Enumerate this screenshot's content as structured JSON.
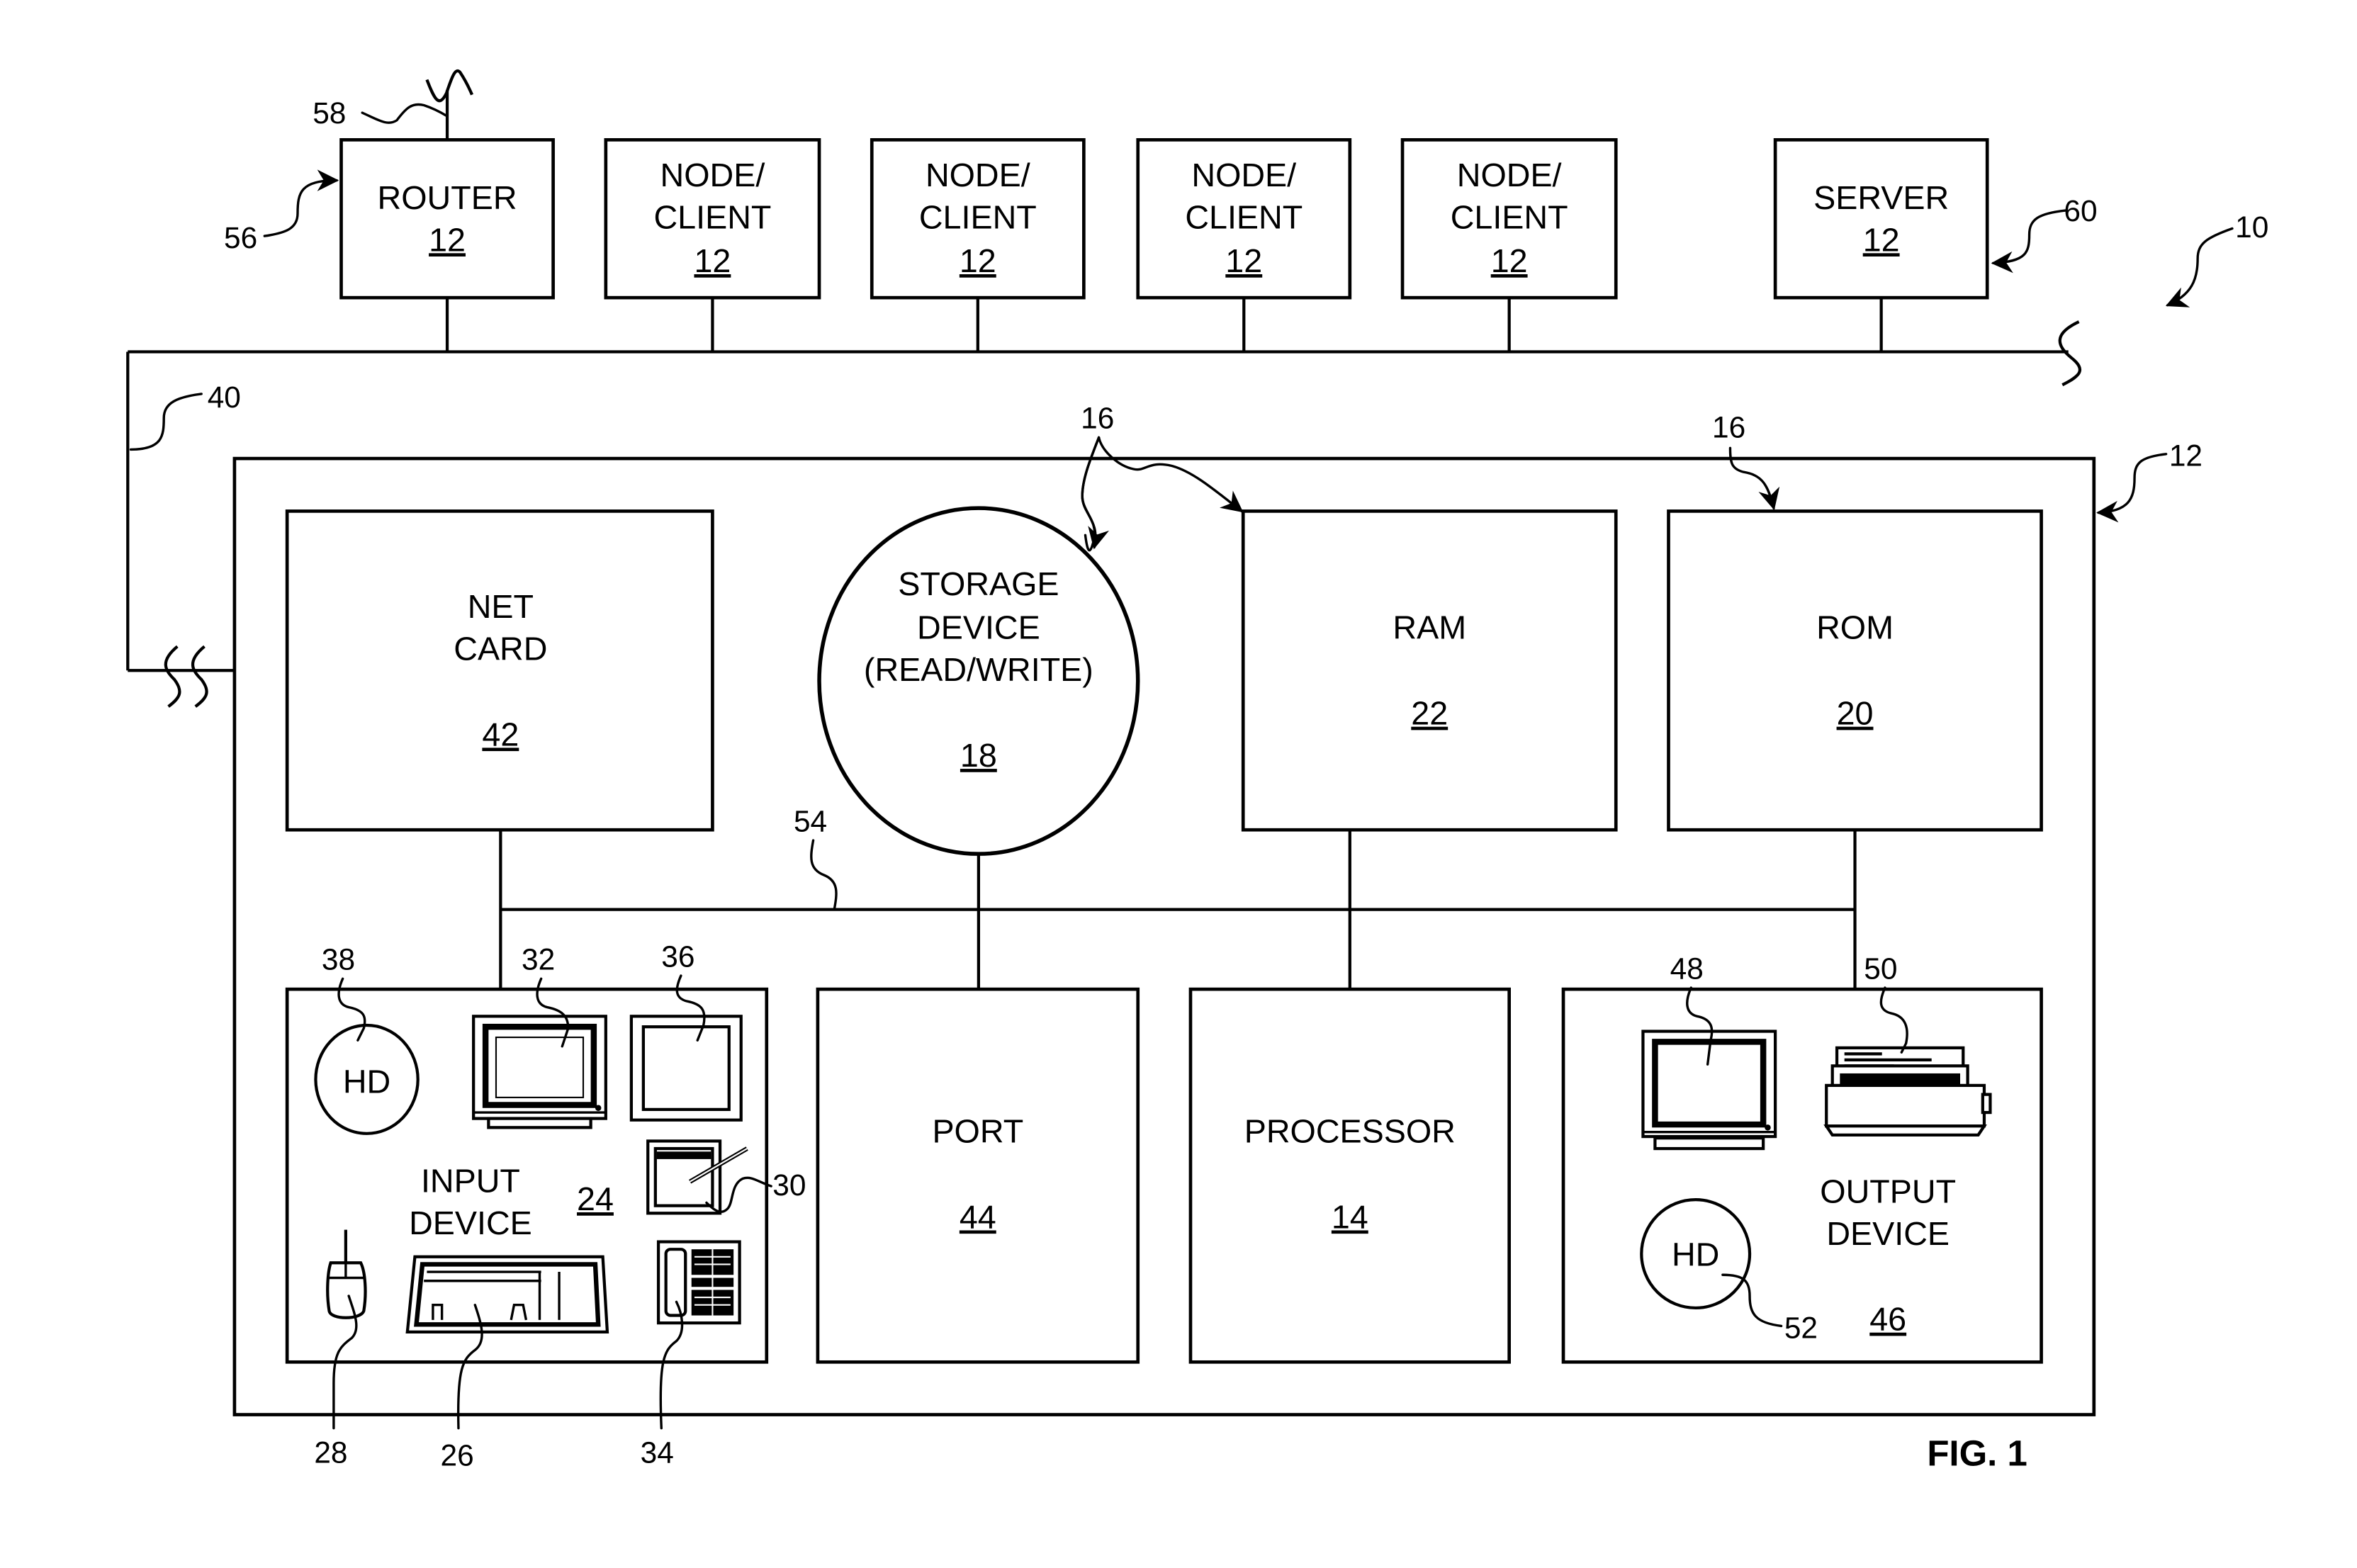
{
  "figure": {
    "title": "FIG. 1",
    "system_ref": "10",
    "computer_ref": "12"
  },
  "network": {
    "bus_ref": "40",
    "devices": [
      {
        "lines": [
          "ROUTER"
        ],
        "ref": "12",
        "callout": "56"
      },
      {
        "lines": [
          "NODE/",
          "CLIENT"
        ],
        "ref": "12"
      },
      {
        "lines": [
          "NODE/",
          "CLIENT"
        ],
        "ref": "12"
      },
      {
        "lines": [
          "NODE/",
          "CLIENT"
        ],
        "ref": "12"
      },
      {
        "lines": [
          "NODE/",
          "CLIENT"
        ],
        "ref": "12"
      },
      {
        "lines": [
          "SERVER"
        ],
        "ref": "12",
        "callout": "60"
      }
    ],
    "antenna_ref": "58"
  },
  "computer": {
    "net_card": {
      "lines": [
        "NET",
        "CARD"
      ],
      "ref": "42"
    },
    "storage": {
      "lines": [
        "STORAGE",
        "DEVICE",
        "(READ/WRITE)"
      ],
      "ref": "18"
    },
    "ram": {
      "label": "RAM",
      "ref": "22"
    },
    "rom": {
      "label": "ROM",
      "ref": "20"
    },
    "memory_ref": "16",
    "internal_bus_ref": "54",
    "port": {
      "label": "PORT",
      "ref": "44"
    },
    "processor": {
      "label": "PROCESSOR",
      "ref": "14"
    },
    "input_device": {
      "lines": [
        "INPUT",
        "DEVICE"
      ],
      "ref": "24",
      "hd_label": "HD",
      "hd_ref": "38",
      "monitor_ref": "32",
      "touchscreen_ref": "36",
      "tablet_ref": "30",
      "mouse_ref": "28",
      "keyboard_ref": "26",
      "phone_ref": "34"
    },
    "output_device": {
      "lines": [
        "OUTPUT",
        "DEVICE"
      ],
      "ref": "46",
      "hd_label": "HD",
      "hd_ref": "52",
      "monitor_ref": "48",
      "printer_ref": "50"
    }
  }
}
